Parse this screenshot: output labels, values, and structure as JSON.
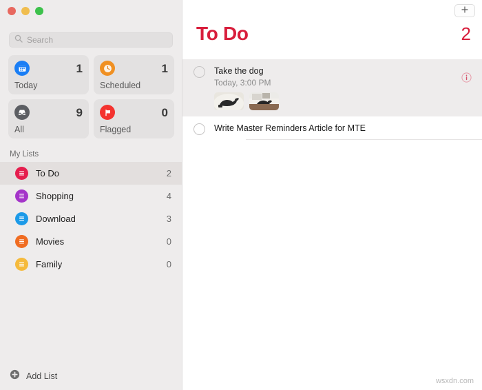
{
  "window": {
    "traffic_lights": [
      {
        "name": "close",
        "color": "#e8685f"
      },
      {
        "name": "minimize",
        "color": "#f0bd4e"
      },
      {
        "name": "zoom",
        "color": "#3cc14b"
      }
    ]
  },
  "sidebar": {
    "search": {
      "placeholder": "Search",
      "value": "",
      "icon": "search-icon"
    },
    "smart_lists": [
      {
        "label": "Today",
        "count": "1",
        "icon": "calendar-icon",
        "color": "#1a7ef5"
      },
      {
        "label": "Scheduled",
        "count": "1",
        "icon": "clock-icon",
        "color": "#f09022"
      },
      {
        "label": "All",
        "count": "9",
        "icon": "inbox-icon",
        "color": "#5c5e63"
      },
      {
        "label": "Flagged",
        "count": "0",
        "icon": "flag-icon",
        "color": "#f4332f"
      }
    ],
    "my_lists_header": "My Lists",
    "lists": [
      {
        "name": "To Do",
        "count": "2",
        "color": "#e51e4e",
        "selected": true
      },
      {
        "name": "Shopping",
        "count": "4",
        "color": "#a435c9",
        "selected": false
      },
      {
        "name": "Download",
        "count": "3",
        "color": "#1c9ae8",
        "selected": false
      },
      {
        "name": "Movies",
        "count": "0",
        "color": "#f06c21",
        "selected": false
      },
      {
        "name": "Family",
        "count": "0",
        "color": "#f5ba3c",
        "selected": false
      }
    ],
    "add_list": {
      "label": "Add List",
      "icon": "plus-circle-icon"
    }
  },
  "main": {
    "add_button": {
      "icon": "plus-icon"
    },
    "title": "To Do",
    "count": "2",
    "accent_color": "#d81e3c",
    "reminders": [
      {
        "title": "Take the dog",
        "due": "Today, 3:00 PM",
        "completed": false,
        "highlighted": true,
        "has_info": true,
        "attachments": [
          {
            "name": "dog-photo-1"
          },
          {
            "name": "dog-photo-2"
          }
        ]
      },
      {
        "title": "Write Master Reminders Article for MTE",
        "due": "",
        "completed": false,
        "highlighted": false,
        "has_info": false,
        "attachments": []
      }
    ]
  },
  "watermark": "wsxdn.com"
}
